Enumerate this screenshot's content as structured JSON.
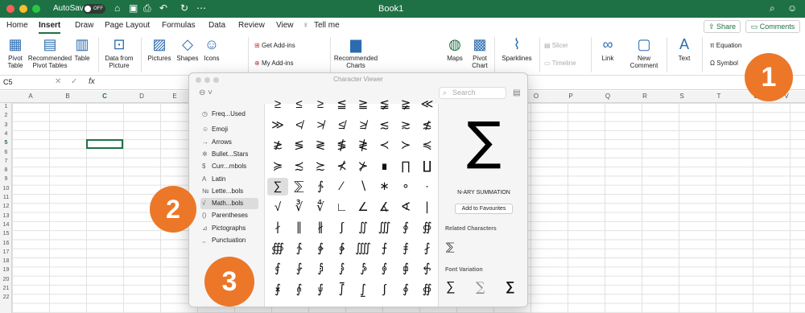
{
  "titlebar": {
    "autosave": "AutoSave",
    "toggle": "OFF",
    "title": "Book1"
  },
  "tabs": [
    "Home",
    "Insert",
    "Draw",
    "Page Layout",
    "Formulas",
    "Data",
    "Review",
    "View",
    "Tell me"
  ],
  "share": "Share",
  "comments": "Comments",
  "ribbon": {
    "pivot_table": "Pivot Table",
    "recommended_pivot_tables": "Recommended Pivot Tables",
    "table": "Table",
    "data_from_picture": "Data from Picture",
    "pictures": "Pictures",
    "shapes": "Shapes",
    "icons": "Icons",
    "get_addins": "Get Add-ins",
    "my_addins": "My Add-ins",
    "recommended_charts": "Recommended Charts",
    "maps": "Maps",
    "pivot_chart": "Pivot Chart",
    "sparklines": "Sparklines",
    "slicer": "Slicer",
    "timeline": "Timeline",
    "link": "Link",
    "new_comment": "New Comment",
    "text": "Text",
    "equation": "Equation",
    "symbol": "Symbol"
  },
  "formula_bar": {
    "name_box": "C5",
    "fx": "fx"
  },
  "columns": [
    "A",
    "B",
    "C",
    "D",
    "E",
    "O",
    "P",
    "Q",
    "R",
    "S",
    "T",
    "U",
    "V"
  ],
  "rows": [
    "1",
    "2",
    "3",
    "4",
    "5",
    "6",
    "7",
    "8",
    "9",
    "10",
    "11",
    "12",
    "13",
    "14",
    "15",
    "16",
    "17",
    "18",
    "19",
    "20",
    "21",
    "22"
  ],
  "character_viewer": {
    "title": "Character Viewer",
    "search_placeholder": "Search",
    "categories": [
      {
        "icon": "◷",
        "label": "Freq...Used"
      },
      {
        "icon": "☺",
        "label": "Emoji"
      },
      {
        "icon": "→",
        "label": "Arrows"
      },
      {
        "icon": "✲",
        "label": "Bullet...Stars"
      },
      {
        "icon": "$",
        "label": "Curr...mbols"
      },
      {
        "icon": "A",
        "label": "Latin"
      },
      {
        "icon": "№",
        "label": "Lette...bols"
      },
      {
        "icon": "√",
        "label": "Math...bols"
      },
      {
        "icon": "()",
        "label": "Parentheses"
      },
      {
        "icon": "⊿",
        "label": "Pictographs"
      },
      {
        "icon": ",,",
        "label": "Punctuation"
      }
    ],
    "glyph_rows": [
      [
        "≥",
        "≤",
        "≥",
        "≦",
        "≧",
        "≨",
        "≩",
        "≪"
      ],
      [
        "≫",
        "≮",
        "≯",
        "≰",
        "≱",
        "≲",
        "≳",
        "≴"
      ],
      [
        "≵",
        "≶",
        "≷",
        "≸",
        "≹",
        "≺",
        "≻",
        "≼"
      ],
      [
        "≽",
        "≾",
        "≿",
        "⊀",
        "⊁",
        "∎",
        "∏",
        "∐"
      ],
      [
        "∑",
        "⅀",
        "∱",
        "∕",
        "∖",
        "∗",
        "∘",
        "∙"
      ],
      [
        "√",
        "∛",
        "∜",
        "∟",
        "∠",
        "∡",
        "∢",
        "∣"
      ],
      [
        "∤",
        "∥",
        "∦",
        "∫",
        "∬",
        "∭",
        "∮",
        "∯"
      ],
      [
        "∰",
        "∱",
        "∲",
        "∳",
        "⨌",
        "⨍",
        "⨎",
        "⨏"
      ],
      [
        "⨐",
        "⨑",
        "⨒",
        "⨓",
        "⨔",
        "⨕",
        "⨖",
        "⨗"
      ],
      [
        "⨘",
        "⨙",
        "⨚",
        "⨛",
        "⨜",
        "∫",
        "∮",
        "∯"
      ]
    ],
    "selected_glyph": "∑",
    "char_name": "N-ARY SUMMATION",
    "add_favourites": "Add to Favourites",
    "related_header": "Related Characters",
    "related": [
      "⅀"
    ],
    "font_variation_header": "Font Variation",
    "variations": [
      "∑",
      "∑",
      "∑"
    ]
  },
  "badges": [
    "1",
    "2",
    "3"
  ],
  "colors": {
    "excel_green": "#1e7145",
    "badge_orange": "#ec7728"
  }
}
